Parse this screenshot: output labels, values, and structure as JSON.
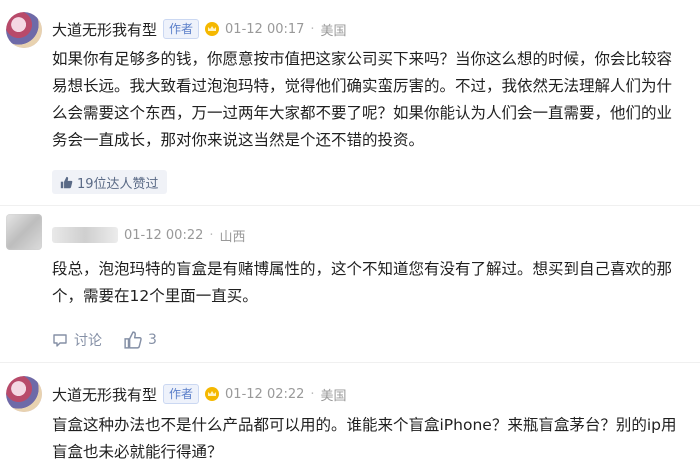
{
  "comments": [
    {
      "username": "大道无形我有型",
      "badge": "作者",
      "time": "01-12 00:17",
      "sep": "·",
      "location": "美国",
      "text": "如果你有足够多的钱，你愿意按市值把这家公司买下来吗？当你这么想的时候，你会比较容易想长远。我大致看过泡泡玛特，觉得他们确实蛮厉害的。不过，我依然无法理解人们为什么会需要这个东西，万一过两年大家都不要了呢？如果你能认为人们会一直需要，他们的业务会一直成长，那对你来说这当然是个还不错的投资。",
      "approve_label": "19位达人赞过"
    },
    {
      "time": "01-12 00:22",
      "sep": "·",
      "location": "山西",
      "text": "段总，泡泡玛特的盲盒是有赌博属性的，这个不知道您有没有了解过。想买到自己喜欢的那个，需要在12个里面一直买。",
      "discuss_label": "讨论",
      "like_count": "3"
    },
    {
      "username": "大道无形我有型",
      "badge": "作者",
      "time": "01-12 02:22",
      "sep": "·",
      "location": "美国",
      "text": "盲盒这种办法也不是什么产品都可以用的。谁能来个盲盒iPhone？来瓶盲盒茅台？别的ip用盲盒也未必就能行得通？"
    }
  ]
}
